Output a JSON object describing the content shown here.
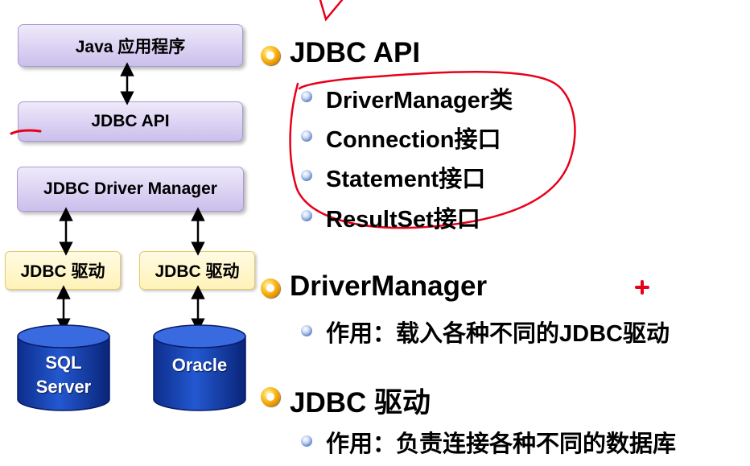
{
  "diagram": {
    "java_app": "Java 应用程序",
    "jdbc_api": "JDBC API",
    "driver_manager": "JDBC Driver Manager",
    "driver_left": "JDBC 驱动",
    "driver_right": "JDBC 驱动",
    "db_left_line1": "SQL",
    "db_left_line2": "Server",
    "db_right": "Oracle"
  },
  "sections": [
    {
      "heading": "JDBC API",
      "items": [
        "DriverManager类",
        "Connection接口",
        "Statement接口",
        "ResultSet接口"
      ]
    },
    {
      "heading": "DriverManager",
      "items": [
        "作用：载入各种不同的JDBC驱动"
      ]
    },
    {
      "heading": "JDBC 驱动",
      "items": [
        "作用：负责连接各种不同的数据库"
      ]
    }
  ],
  "colors": {
    "box_fill": "#d9d0f2",
    "driver_fill": "#fff2b8",
    "db_blue": "#1840b0",
    "annotation_red": "#e8001a",
    "bullet_orange": "#f0a000"
  }
}
